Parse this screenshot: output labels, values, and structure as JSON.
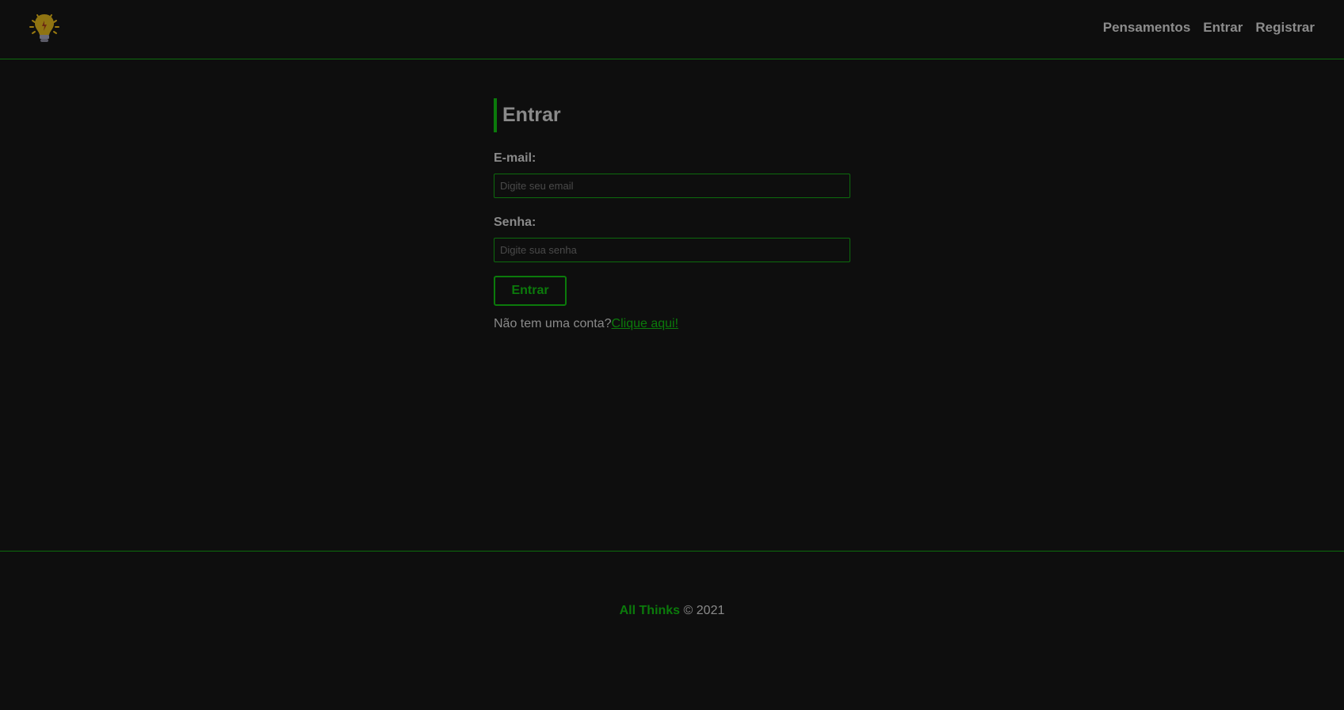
{
  "header": {
    "logo_icon": "lightbulb-icon",
    "nav": [
      {
        "label": "Pensamentos"
      },
      {
        "label": "Entrar"
      },
      {
        "label": "Registrar"
      }
    ]
  },
  "login_form": {
    "title": "Entrar",
    "email_label": "E-mail:",
    "email_placeholder": "Digite seu email",
    "email_value": "",
    "password_label": "Senha:",
    "password_placeholder": "Digite sua senha",
    "password_value": "",
    "submit_label": "Entrar",
    "register_prompt": "Não tem uma conta?",
    "register_link": "Clique aqui!"
  },
  "footer": {
    "brand": "All Thinks",
    "copyright": "© 2021"
  },
  "colors": {
    "background": "#0e0e0e",
    "accent": "#0b7a0b",
    "text": "#8a8a8a"
  }
}
